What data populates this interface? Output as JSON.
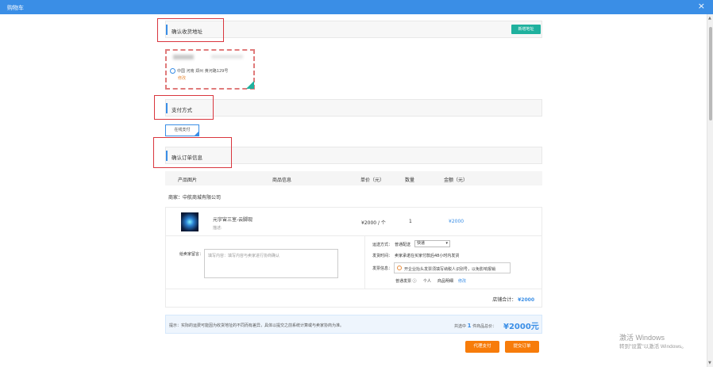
{
  "window": {
    "title": "购物车",
    "close_glyph": "×"
  },
  "sections": {
    "address": "确认收货地址",
    "payment": "支付方式",
    "order": "确认订单信息"
  },
  "address": {
    "new_button": "新增地址",
    "line": "中国 河南 郑州 黄河路129号",
    "edit": "修改"
  },
  "payment": {
    "method": "在线支付"
  },
  "table": {
    "headers": [
      "产品图片",
      "商品信息",
      "单价（元）",
      "数量",
      "金额（元）"
    ]
  },
  "shop": {
    "label": "商家：中航商城有限公司"
  },
  "item": {
    "name": "元宇宙三室-云脚现",
    "desc": "描述:",
    "price": "¥2000 / 个",
    "qty": "1",
    "amount": "¥2000"
  },
  "options": {
    "message_label": "给卖家留言：",
    "message_placeholder": "填写内容：填写内容与卖家进行协商确认",
    "shipping_label": "运送方式：",
    "shipping_value": "普通配送",
    "shipping_select": "快递",
    "ship_time_label": "发货时间：",
    "ship_time_value": "卖家承诺在买家付款后48小时内发货",
    "invoice_label": "发票信息：",
    "invoice_note": "开企业抬头发票须填写纳税人识别号，以免影响报销",
    "invoice_type": "普通发票 ⓘ",
    "invoice_person": "个人",
    "invoice_detail": "商品明细",
    "invoice_edit": "修改",
    "total_label": "店铺合计：",
    "total_value": "¥2000"
  },
  "summary": {
    "tip": "提示：实际的运费可能因为收货地址的不同而有差异，具体以提交之前系统计算或与卖家协商为准。",
    "count_prefix": "共选中",
    "count": "1",
    "count_suffix": "件商品总价：",
    "total": "¥2000元"
  },
  "buttons": {
    "proxy_pay": "代理支付",
    "submit": "提交订单"
  },
  "watermark": {
    "line1": "激活 Windows",
    "line2": "转到\"设置\"以激活 Windows。"
  },
  "colors": {
    "titlebar": "#3a8ee6",
    "green": "#1fb19e",
    "orange": "#f77c0a",
    "highlight_red": "#d9363e"
  }
}
